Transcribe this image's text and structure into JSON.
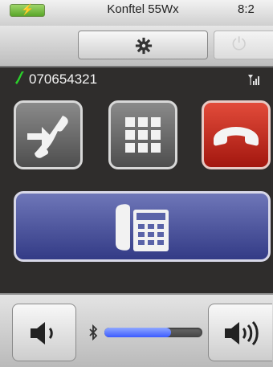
{
  "status_bar": {
    "device_name": "Konftel 55Wx",
    "clock": "8:2",
    "battery_icon": "battery-charging-icon"
  },
  "toolbar": {
    "settings_icon": "gear-icon",
    "extra_icon": "power-icon"
  },
  "call": {
    "number": "070654321",
    "call_icon": "phone-handset-icon",
    "signal_icon": "signal-strength-icon"
  },
  "actions": {
    "transfer_icon": "call-transfer-icon",
    "keypad_icon": "keypad-icon",
    "hangup_icon": "hang-up-icon",
    "phone_icon": "desk-phone-icon"
  },
  "volume": {
    "down_icon": "speaker-low-icon",
    "up_icon": "speaker-high-icon",
    "bluetooth_icon": "bluetooth-icon",
    "level": 0.68
  },
  "colors": {
    "hangup": "#c42a1e",
    "phone_button": "#3d4590",
    "call_icon": "#2bd12b",
    "volume_fill": "#4a6cff"
  }
}
